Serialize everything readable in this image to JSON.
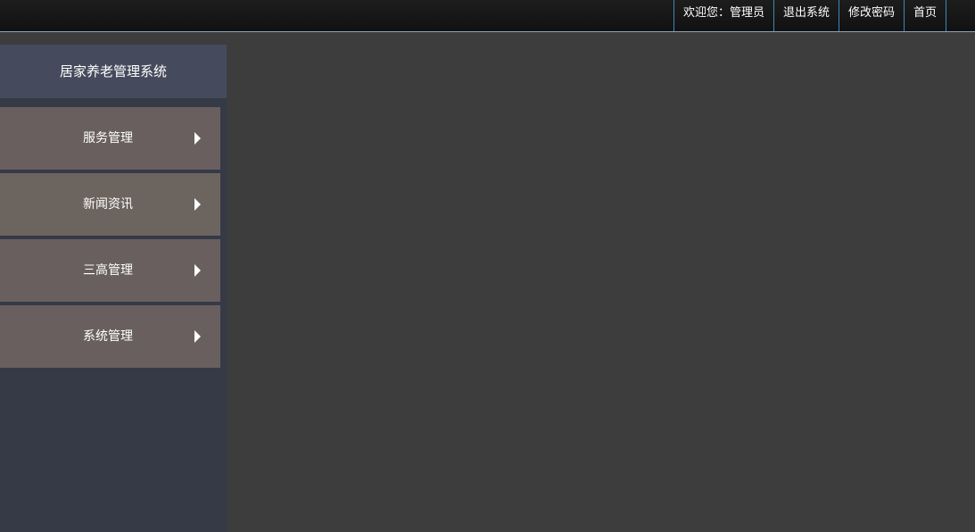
{
  "header": {
    "welcome": "欢迎您：管理员",
    "logout": "退出系统",
    "change_password": "修改密码",
    "home": "首页"
  },
  "sidebar": {
    "title": "居家养老管理系统",
    "items": [
      {
        "label": "服务管理",
        "icon": "caret-right-icon"
      },
      {
        "label": "新闻资讯",
        "icon": "caret-right-icon"
      },
      {
        "label": "三高管理",
        "icon": "caret-right-icon"
      },
      {
        "label": "系统管理",
        "icon": "caret-right-icon"
      }
    ]
  },
  "colors": {
    "topbar": "#151515",
    "topbar_divider": "#3e88b8",
    "sidebar_bg": "#363a47",
    "sidebar_title_bg": "#454b5d",
    "menu_item_bg": "#695f5f",
    "content_bg": "#3d3d3d"
  }
}
